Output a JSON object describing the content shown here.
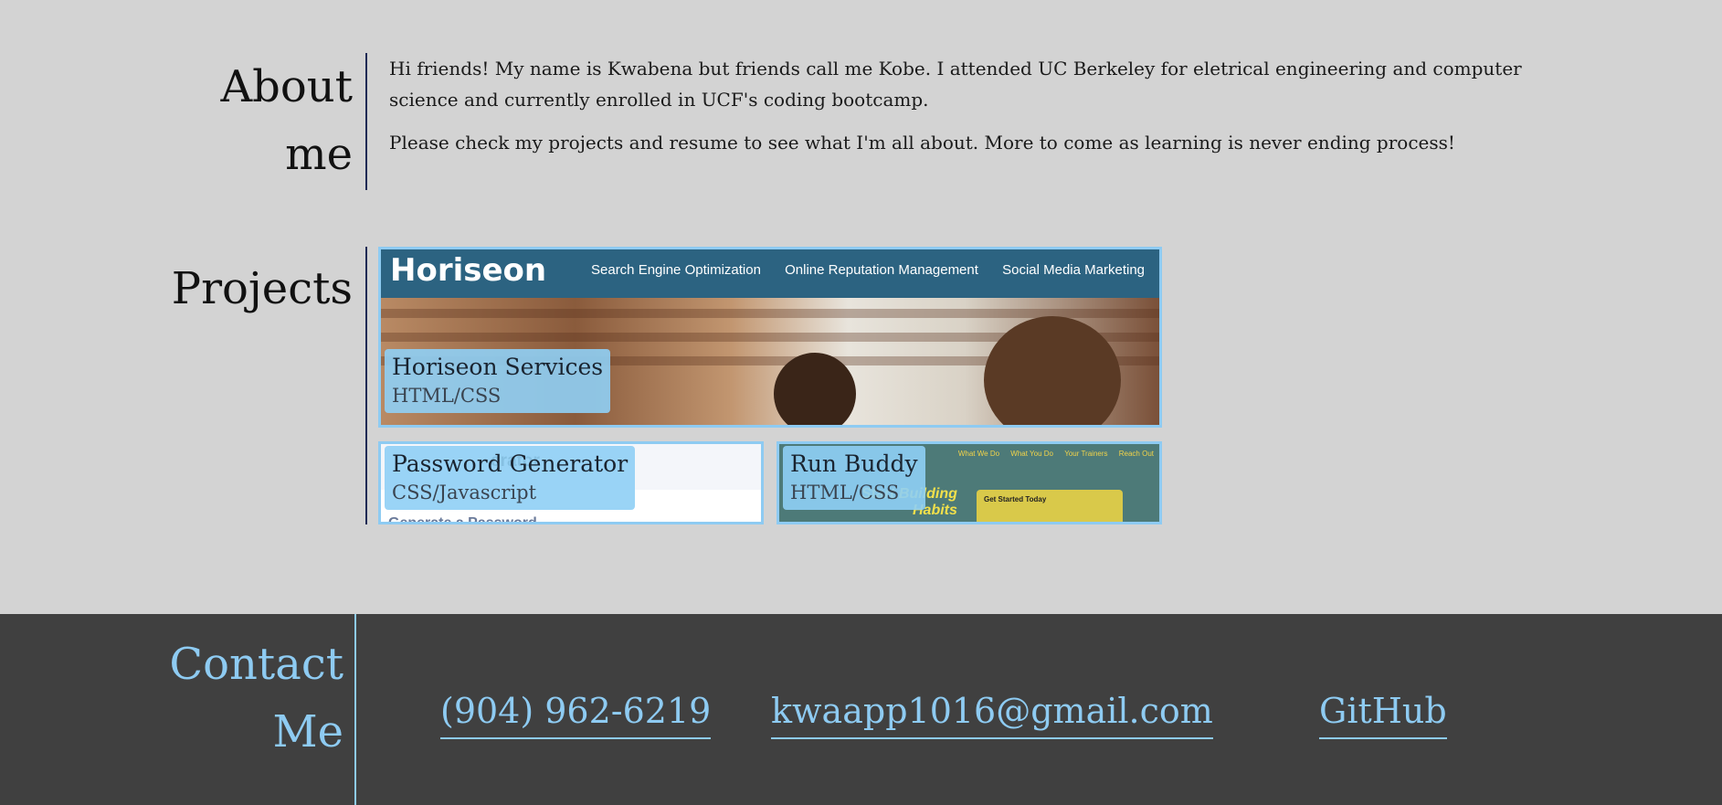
{
  "about": {
    "title_line1": "About",
    "title_line2": "me",
    "paragraph1": "Hi friends! My name is Kwabena but friends call me Kobe. I attended UC Berkeley for eletrical engineering and computer science and currently enrolled in UCF's coding bootcamp.",
    "paragraph2": "Please check my projects and resume to see what I'm all about. More to come as learning is never ending process!"
  },
  "projects": {
    "title": "Projects",
    "items": [
      {
        "name": "Horiseon Services",
        "tech": "HTML/CSS",
        "preview": {
          "logo": "Horiseon",
          "nav": [
            "Search Engine Optimization",
            "Online Reputation Management",
            "Social Media Marketing"
          ]
        }
      },
      {
        "name": "Password Generator",
        "tech": "CSS/Javascript",
        "preview": {
          "header": "erator",
          "subtext": "Generate a Password"
        }
      },
      {
        "name": "Run Buddy",
        "tech": "HTML/CSS",
        "preview": {
          "nav": [
            "What We Do",
            "What You Do",
            "Your Trainers",
            "Reach Out"
          ],
          "headline_line1": "Start Building",
          "headline_line2": "Habits",
          "box_title": "Get Started Today"
        }
      }
    ]
  },
  "contact": {
    "title_line1": "Contact",
    "title_line2": "Me",
    "phone": "(904) 962-6219",
    "email": "kwaapp1016@gmail.com",
    "github": "GitHub"
  },
  "colors": {
    "background": "#d3d3d3",
    "footer": "#404040",
    "accent": "#8ecbf2",
    "divider": "#1e2a55"
  }
}
